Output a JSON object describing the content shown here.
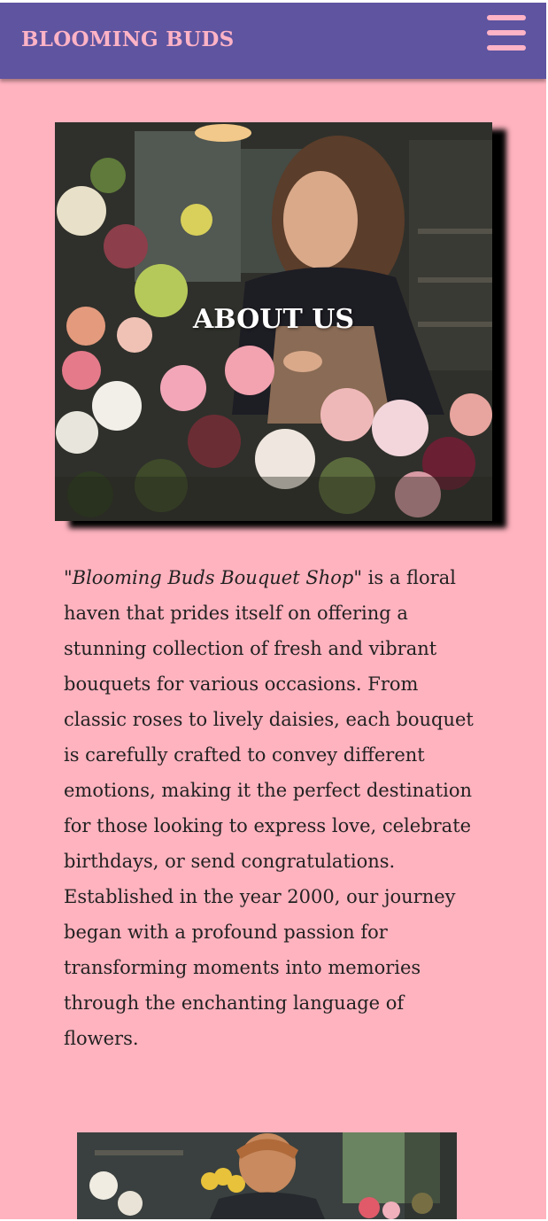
{
  "header": {
    "brand": "BLOOMING BUDS",
    "menu_icon": "hamburger-menu-icon"
  },
  "hero": {
    "title": "ABOUT US",
    "image_description_icon": "florist-photo"
  },
  "about": {
    "shop_name": "\"Blooming Buds Bouquet Shop\"",
    "body": " is a floral haven that prides itself on offering a stunning collection of fresh and vibrant bouquets for various occasions. From classic roses to lively daisies, each bouquet is carefully crafted to convey different emotions, making it the perfect destination for those looking to express love, celebrate birthdays, or send congratulations. Established in the year 2000, our journey began with a profound passion for transforming moments into memories through the enchanting language of flowers."
  },
  "colors": {
    "page_bg": "#ffb3bf",
    "header_bg": "#5e54a0",
    "brand": "#ffb3c6"
  }
}
